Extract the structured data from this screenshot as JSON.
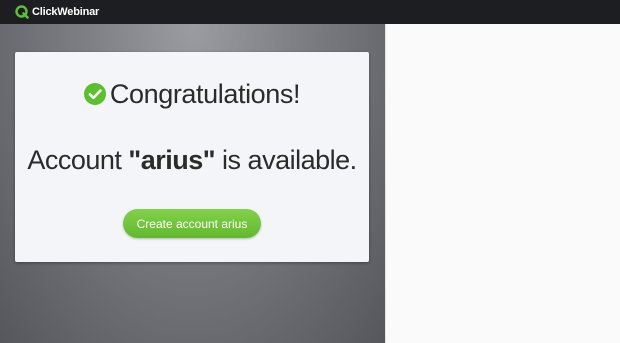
{
  "header": {
    "brand": "ClickWebinar",
    "logo_icon": "clickwebinar-logo-icon"
  },
  "card": {
    "icon": "check-circle-icon",
    "heading": "Congratulations!",
    "message_prefix": "Account ",
    "account_name": "\"arius\"",
    "message_suffix": " is available.",
    "button_label": "Create account arius"
  },
  "colors": {
    "topbar": "#1d1e22",
    "accent_green": "#6cc43a",
    "card_bg": "#f4f5f9",
    "text": "#2b2b2b"
  }
}
